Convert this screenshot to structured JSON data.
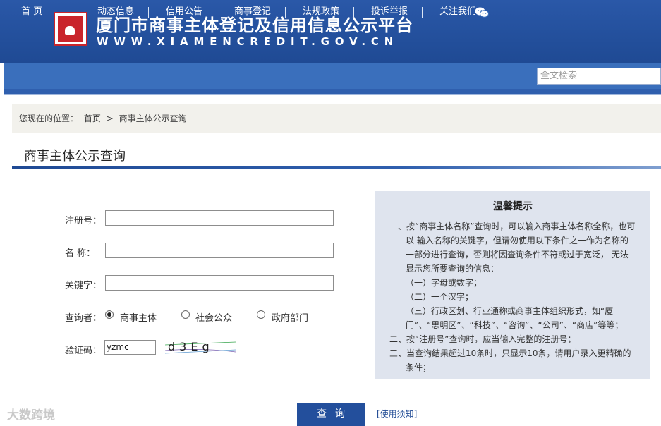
{
  "header": {
    "title": "厦门市商事主体登记及信用信息公示平台",
    "url": "WWW.XIAMENCREDIT.GOV.CN"
  },
  "nav": {
    "items": [
      "首 页",
      "动态信息",
      "信用公告",
      "商事登记",
      "法规政策",
      "投诉举报",
      "关注我们"
    ],
    "search_placeholder": "全文检索"
  },
  "breadcrumb": {
    "prefix": "您现在的位置：",
    "home": "首页",
    "separator": ">",
    "current": "商事主体公示查询"
  },
  "page_title": "商事主体公示查询",
  "form": {
    "reg_label": "注册号：",
    "name_label": "名 称：",
    "keyword_label": "关键字：",
    "querier_label": "查询者：",
    "querier_options": [
      "商事主体",
      "社会公众",
      "政府部门"
    ],
    "selected_querier": "商事主体",
    "captcha_label": "验证码：",
    "captcha_value": "yzmc",
    "captcha_text": "d3Eg",
    "submit_label": "查询",
    "usage_link": "[使用须知]"
  },
  "tips": {
    "title": "温馨提示",
    "lines": [
      "一、按“商事主体名称”查询时，可以输入商事主体名称全称，也可",
      "以 输入名称的关键字，但请勿使用以下条件之一作为名称的",
      "一部分进行查询，否则将因查询条件不符或过于宽泛， 无法",
      "显示您所要查询的信息：",
      "（一）字母或数字；",
      "（二）一个汉字；",
      "（三）行政区划、行业通称或商事主体组织形式，如“厦",
      "门”、“思明区”、“科技”、“咨询”、“公司”、“商店”等等；",
      "二、按“注册号”查询时，应当输入完整的注册号；",
      "三、当查询结果超过10条时，只显示10条，请用户录入更精确的",
      "条件；"
    ]
  },
  "watermark": "大数跨境"
}
